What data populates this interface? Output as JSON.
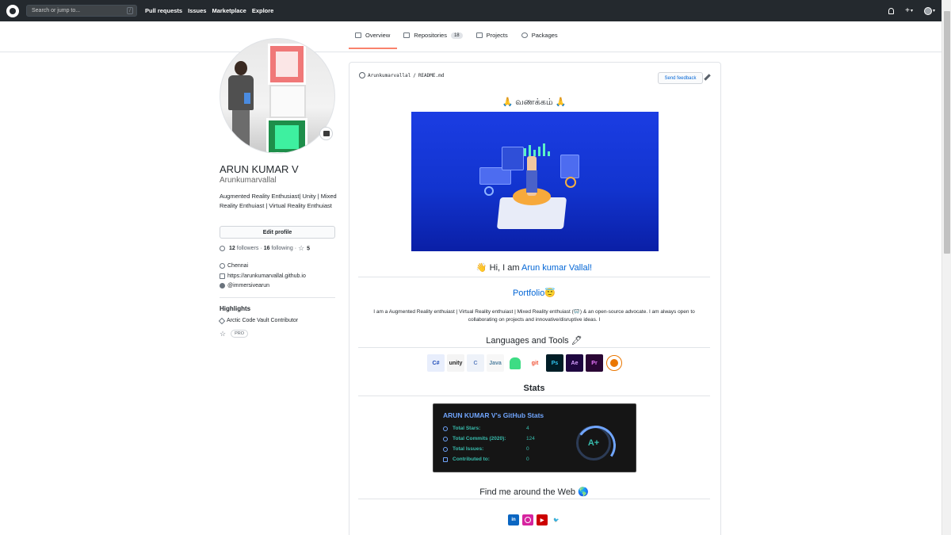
{
  "header": {
    "search_placeholder": "Search or jump to...",
    "search_key": "/",
    "nav": [
      "Pull requests",
      "Issues",
      "Marketplace",
      "Explore"
    ],
    "plus": "+"
  },
  "tabs": [
    {
      "label": "Overview",
      "active": true
    },
    {
      "label": "Repositories",
      "count": "18"
    },
    {
      "label": "Projects"
    },
    {
      "label": "Packages"
    }
  ],
  "profile": {
    "name": "ARUN KUMAR V",
    "login": "Arunkumarvallal",
    "bio": "Augmented Reality Enthusiast| Unity | Mixed Reality Enthuiast | Virtual Reality Enthuiast",
    "edit_label": "Edit profile",
    "followers_count": "12",
    "followers_label": "followers",
    "dot1": "·",
    "following_count": "16",
    "following_label": "following",
    "dot2": "·",
    "stars": "5",
    "location": "Chennai",
    "website": "https://arunkumarvallal.github.io",
    "twitter": "@immersivearun",
    "highlights_title": "Highlights",
    "highlight_1": "Arctic Code Vault Contributor",
    "pro": "PRO"
  },
  "readme": {
    "path_user": "Arunkumarvallal",
    "path_sep": "/",
    "path_file": "README.md",
    "feedback_label": "Send feedback",
    "greeting": "🙏 வணக்கம் 🙏",
    "hi_prefix": "👋 Hi, I am ",
    "hi_name": "Arun kumar Vallal!",
    "portfolio": "Portfolio😇",
    "about": "I am a Augmented Reality enthuiast | Virtual Reality enthuiast | Mixed Reality enthuiast (🥽) & an open-source advocate. I am always open to collaborating on projects and innovative/disruptive ideas. I",
    "languages_title": "Languages and Tools 🖊",
    "stats_title": "Stats",
    "web_title": "Find me around the Web 🌎"
  },
  "tools": [
    {
      "label": "C#",
      "bg": "#e8eefc",
      "fg": "#1e4bb8"
    },
    {
      "label": "unity",
      "bg": "#f4f4f4",
      "fg": "#222222"
    },
    {
      "label": "C",
      "bg": "#eef2f9",
      "fg": "#5c7fbf"
    },
    {
      "label": "Java",
      "bg": "#f7f7f7",
      "fg": "#5382a1"
    },
    {
      "label": "",
      "bg": "#ffffff",
      "fg": "#3ddc84"
    },
    {
      "label": "git",
      "bg": "#ffffff",
      "fg": "#f05033"
    },
    {
      "label": "Ps",
      "bg": "#001d26",
      "fg": "#31c5f0"
    },
    {
      "label": "Ae",
      "bg": "#1f0740",
      "fg": "#d8a1ff"
    },
    {
      "label": "Pr",
      "bg": "#2a0634",
      "fg": "#ea77ff"
    },
    {
      "label": "",
      "bg": "#ffffff",
      "fg": "#ea7600"
    }
  ],
  "stats": {
    "title": "ARUN KUMAR V's GitHub Stats",
    "rows": [
      {
        "label": "Total Stars:",
        "value": "4"
      },
      {
        "label": "Total Commits (2020):",
        "value": "124"
      },
      {
        "label": "Total Issues:",
        "value": "0"
      },
      {
        "label": "Contributed to:",
        "value": "0"
      }
    ],
    "grade": "A+"
  },
  "socials": [
    {
      "label": "in",
      "bg": "#0a66c2"
    },
    {
      "label": "",
      "bg": "#d6249f"
    },
    {
      "label": "▶",
      "bg": "#cc0000"
    },
    {
      "label": "🐦",
      "bg": "#ffffff"
    }
  ],
  "colors": {
    "accent": "#0366d6",
    "tab_active": "#f9826c",
    "header_bg": "#24292e"
  }
}
